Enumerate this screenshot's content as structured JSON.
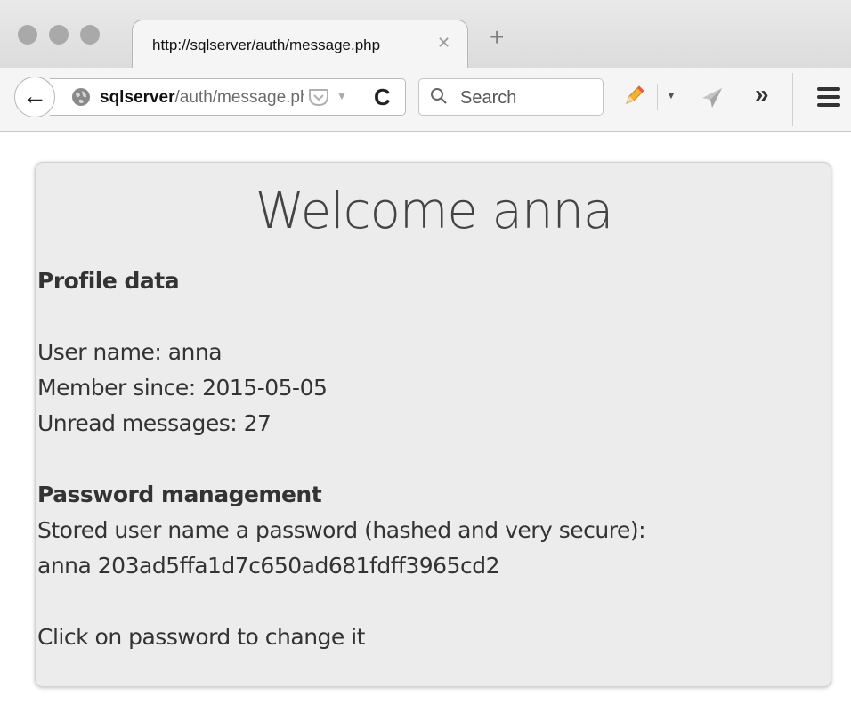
{
  "tab": {
    "title": "http://sqlserver/auth/message.php",
    "close": "✕",
    "new_tab": "+"
  },
  "nav": {
    "back": "←",
    "url_host": "sqlserver",
    "url_path": "/auth/message.php",
    "reload": "C",
    "search_placeholder": "Search",
    "overflow": "»"
  },
  "page": {
    "welcome": "Welcome anna",
    "profile_heading": "Profile data",
    "user_name": "User name: anna",
    "member_since": "Member since: 2015-05-05",
    "unread_messages": "Unread messages: 27",
    "password_heading": "Password management",
    "stored_text": "Stored user name a password (hashed and very secure):",
    "password_line": "anna 203ad5ffa1d7c650ad681fdff3965cd2",
    "change_hint": "Click on password to change it"
  },
  "colors": {
    "tabbar": "#dcdcdc",
    "panel": "#ececec",
    "text": "#333333"
  },
  "icons": [
    "back-arrow-icon",
    "globe-icon",
    "pocket-icon",
    "reload-icon",
    "search-icon",
    "pencil-icon",
    "send-icon",
    "overflow-icon",
    "hamburger-menu-icon"
  ]
}
